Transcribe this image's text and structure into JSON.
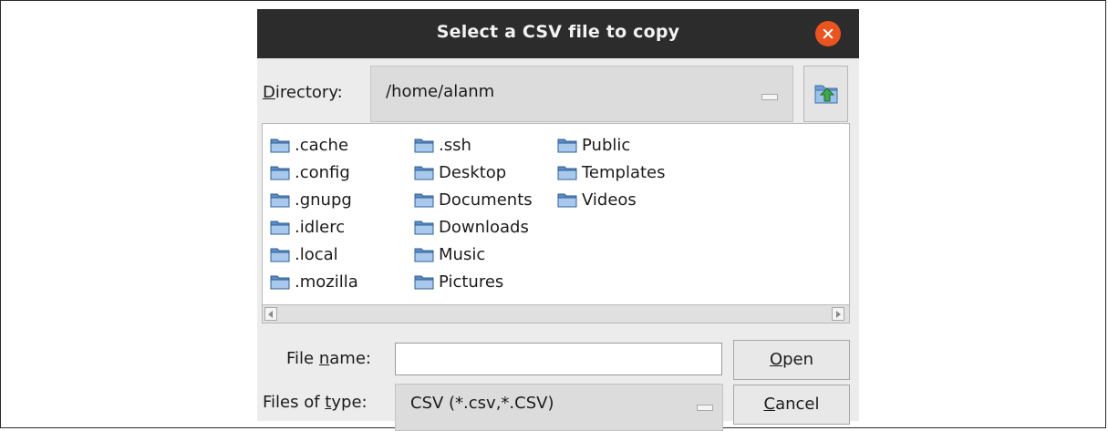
{
  "dialog": {
    "title": "Select a CSV file to copy",
    "close_icon": "close-icon"
  },
  "directory": {
    "label_pre": "",
    "label_accel": "D",
    "label_post": "irectory:",
    "value": "/home/alanm",
    "up_icon": "folder-up-icon"
  },
  "files": {
    "columns": [
      [
        ".cache",
        ".config",
        ".gnupg",
        ".idlerc",
        ".local",
        ".mozilla"
      ],
      [
        ".ssh",
        "Desktop",
        "Documents",
        "Downloads",
        "Music",
        "Pictures"
      ],
      [
        "Public",
        "Templates",
        "Videos"
      ]
    ],
    "item_icon": "folder-icon"
  },
  "file_name": {
    "label_pre": "File ",
    "label_accel": "n",
    "label_post": "ame:",
    "value": "",
    "placeholder": ""
  },
  "file_type": {
    "label_pre": "Files of ",
    "label_accel": "t",
    "label_post": "ype:",
    "value": "CSV (*.csv,*.CSV)"
  },
  "buttons": {
    "open_accel": "O",
    "open_rest": "pen",
    "cancel_accel": "C",
    "cancel_rest": "ancel"
  },
  "colors": {
    "titlebar": "#2c2c2c",
    "close": "#e95420",
    "folder": "#7ea6d4"
  }
}
